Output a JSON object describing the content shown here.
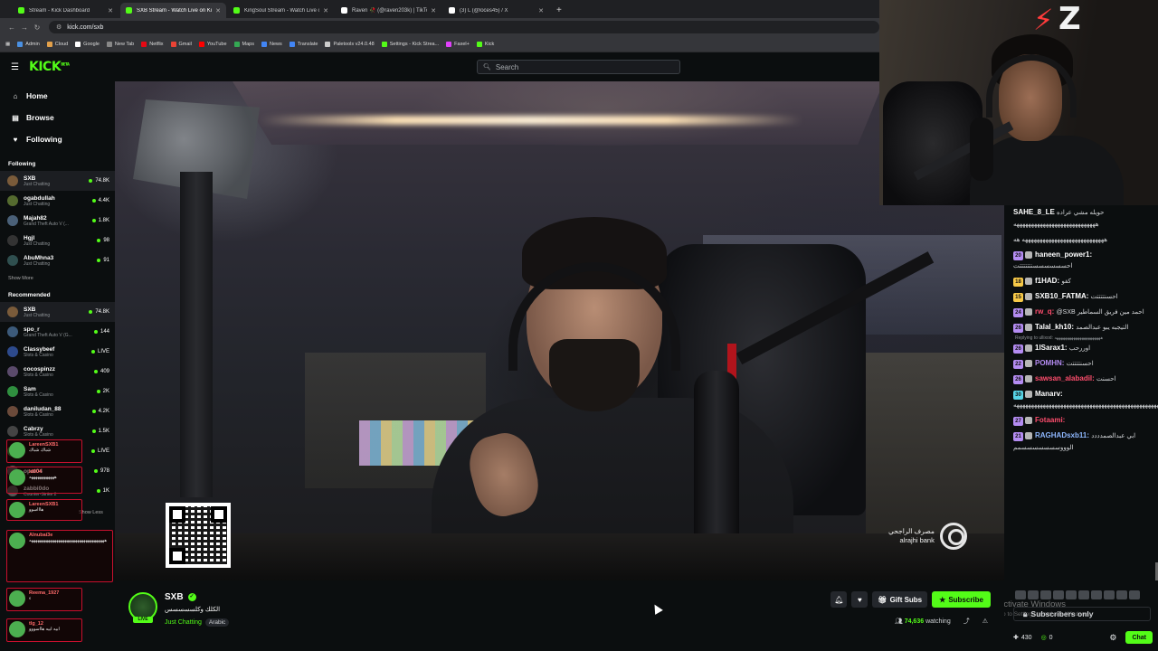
{
  "browser": {
    "tabs": [
      {
        "label": "Stream - Kick Dashboard",
        "color": "#53fc18"
      },
      {
        "label": "SXB Stream - Watch Live on Kick",
        "color": "#53fc18"
      },
      {
        "label": "KingSoul Stream - Watch Live on Kick",
        "color": "#53fc18"
      },
      {
        "label": "Raven 🥀 (@raven203k) | TikTok",
        "color": "#ffffff"
      },
      {
        "label": "(3) L (@loces45) / X",
        "color": "#ffffff"
      }
    ],
    "new_tab": "+",
    "url": "kick.com/sxb",
    "bookmarks": [
      {
        "label": "Admin",
        "color": "#4a90e2"
      },
      {
        "label": "Cloud",
        "color": "#e2a04a"
      },
      {
        "label": "Google",
        "color": "#ffffff"
      },
      {
        "label": "New Tab",
        "color": "#888888"
      },
      {
        "label": "Netflix",
        "color": "#e50914"
      },
      {
        "label": "Gmail",
        "color": "#ea4335"
      },
      {
        "label": "YouTube",
        "color": "#ff0000"
      },
      {
        "label": "Maps",
        "color": "#34a853"
      },
      {
        "label": "News",
        "color": "#4285f4"
      },
      {
        "label": "Translate",
        "color": "#4285f4"
      },
      {
        "label": "Paletools v24.0.48",
        "color": "#cccccc"
      },
      {
        "label": "Settings - Kick Strea...",
        "color": "#53fc18"
      },
      {
        "label": "Faxel+",
        "color": "#e040fb"
      },
      {
        "label": "Kick",
        "color": "#53fc18"
      }
    ]
  },
  "kick": {
    "logo": "KICK",
    "logo_tag": "BETA",
    "search_placeholder": "Search"
  },
  "sidebar": {
    "nav": [
      {
        "label": "Home",
        "icon": "⌂"
      },
      {
        "label": "Browse",
        "icon": "▤"
      },
      {
        "label": "Following",
        "icon": "♥"
      }
    ],
    "following_title": "Following",
    "following": [
      {
        "name": "SXB",
        "category": "Just Chatting",
        "viewers": "74.8K",
        "color": "#7a5b3a"
      },
      {
        "name": "ogabdullah",
        "category": "Just Chatting",
        "viewers": "4.4K",
        "color": "#556b2f"
      },
      {
        "name": "Majah82",
        "category": "Grand Theft Auto V (...",
        "viewers": "1.8K",
        "color": "#4a6078"
      },
      {
        "name": "Hgjl",
        "category": "Just Chatting",
        "viewers": "98",
        "color": "#333333"
      },
      {
        "name": "AbuMhna3",
        "category": "Just Chatting",
        "viewers": "91",
        "color": "#2f4f4f"
      }
    ],
    "show_more": "Show More",
    "recommended_title": "Recommended",
    "recommended": [
      {
        "name": "SXB",
        "category": "Just Chatting",
        "viewers": "74.8K",
        "color": "#7a5b3a"
      },
      {
        "name": "spo_r",
        "category": "Grand Theft Auto V (G...",
        "viewers": "144",
        "color": "#3c5a7a"
      },
      {
        "name": "Classybeef",
        "category": "Slots & Casino",
        "viewers": "LIVE",
        "color": "#2d4a8c"
      },
      {
        "name": "cocospinzz",
        "category": "Slots & Casino",
        "viewers": "409",
        "color": "#5a4a6b"
      },
      {
        "name": "Sam",
        "category": "Slots & Casino",
        "viewers": "2K",
        "color": "#2f8f3f"
      },
      {
        "name": "daniludan_88",
        "category": "Slots & Casino",
        "viewers": "4.2K",
        "color": "#6b4a3a"
      },
      {
        "name": "Cabrzy",
        "category": "Slots & Casino",
        "viewers": "1.5K",
        "color": "#444444"
      },
      {
        "name": "",
        "category": "",
        "viewers": "LIVE",
        "color": "#2f8f3f"
      },
      {
        "name": "opat04",
        "category": "",
        "viewers": "978",
        "color": "#555555"
      },
      {
        "name": "zabbi0do",
        "category": "Counter-Strike 2",
        "viewers": "1K",
        "color": "#555555"
      }
    ],
    "show_less": "Show Less",
    "overlay_chat": [
      {
        "user": "LareenSXB1",
        "text": "شباك شباك"
      },
      {
        "user": "id004",
        "text": "ههههههههههههه"
      },
      {
        "user": "LareenSXB1",
        "text": "هاااسوو"
      },
      {
        "user": "Alnubai3e",
        "text": "ههههههههههههههههههههههههههههههههههههه"
      },
      {
        "user": "Reema_1927",
        "text": "ء"
      },
      {
        "user": "tlg_12",
        "text": "ابيه ابيه هااسووو"
      }
    ]
  },
  "video": {
    "bank_ar": "مصرف الراجحي",
    "bank_en": "alrajhi bank"
  },
  "chat": {
    "messages": [
      {
        "badge": "",
        "badge_color": "",
        "user": "SAHE_8_LE",
        "user_color": "#ffffff",
        "text": "حويله مشي عراده ههههههههههههههههههههههههههههه"
      },
      {
        "badge": "",
        "badge_color": "",
        "user": "",
        "user_color": "#ffffff",
        "text": "ههههههههههههههههههههههههههههه هه"
      },
      {
        "badge": "20",
        "badge_color": "#b48cf2",
        "user": "haneen_power1:",
        "user_color": "#ffffff",
        "text": "احسسسسسسنتتتتتتت"
      },
      {
        "badge": "18",
        "badge_color": "#f7c948",
        "user": "f1HAD:",
        "user_color": "#ffffff",
        "text": "كفو"
      },
      {
        "badge": "15",
        "badge_color": "#f7c948",
        "user": "SXB10_FATMA:",
        "user_color": "#ffffff",
        "text": "احسنتتتتت"
      },
      {
        "badge": "24",
        "badge_color": "#b48cf2",
        "user": "rw_q:",
        "user_color": "#ff4d6d",
        "text": "@SXB احمد مين فريق السماطير"
      },
      {
        "badge": "26",
        "badge_color": "#b48cf2",
        "user": "Talal_kh10:",
        "user_color": "#ffffff",
        "text": "التيجبه يبو عبدالصمد"
      },
      {
        "badge": "",
        "badge_color": "",
        "user": "",
        "user_color": "#8d9296",
        "text": "Replying to ullixod: ههههههههههههههههههههههه"
      },
      {
        "badge": "26",
        "badge_color": "#b48cf2",
        "user": "1lSarax1:",
        "user_color": "#ffffff",
        "text": "اوررحب"
      },
      {
        "badge": "22",
        "badge_color": "#b48cf2",
        "user": "POMHN:",
        "user_color": "#b48cf2",
        "text": "احسنتتتتت"
      },
      {
        "badge": "26",
        "badge_color": "#b48cf2",
        "user": "sawsan_alabadil:",
        "user_color": "#ff4d6d",
        "text": "احسنت"
      },
      {
        "badge": "30",
        "badge_color": "#57d4e6",
        "user": "Manarv:",
        "user_color": "#ffffff",
        "text": "ههههههههههههههههههههههههههههههههههههههههههههههههههههههههههههههههههههههههههههههههه"
      },
      {
        "badge": "27",
        "badge_color": "#b48cf2",
        "user": "Fotaami:",
        "user_color": "#ff4d6d",
        "text": ""
      },
      {
        "badge": "21",
        "badge_color": "#b48cf2",
        "user": "RAGHADsxb11:",
        "user_color": "#8fb8ff",
        "text": "ابي عبدالصمدددد الوووسسسسسسسمم"
      }
    ],
    "subs_only": "Subscribers only",
    "activate_title": "Activate Windows",
    "activate_sub": "Go to Settings to activate Windows.",
    "kick_count": "430",
    "zero_count": "0",
    "chat_button": "Chat"
  },
  "channel": {
    "name": "SXB",
    "live_label": "LIVE",
    "title": "الكلك وكلسسسسس",
    "category": "Just Chatting",
    "language": "Arabic",
    "gift_subs": "Gift Subs",
    "subscribe": "Subscribe",
    "viewers": "74,636",
    "watching": "watching"
  }
}
